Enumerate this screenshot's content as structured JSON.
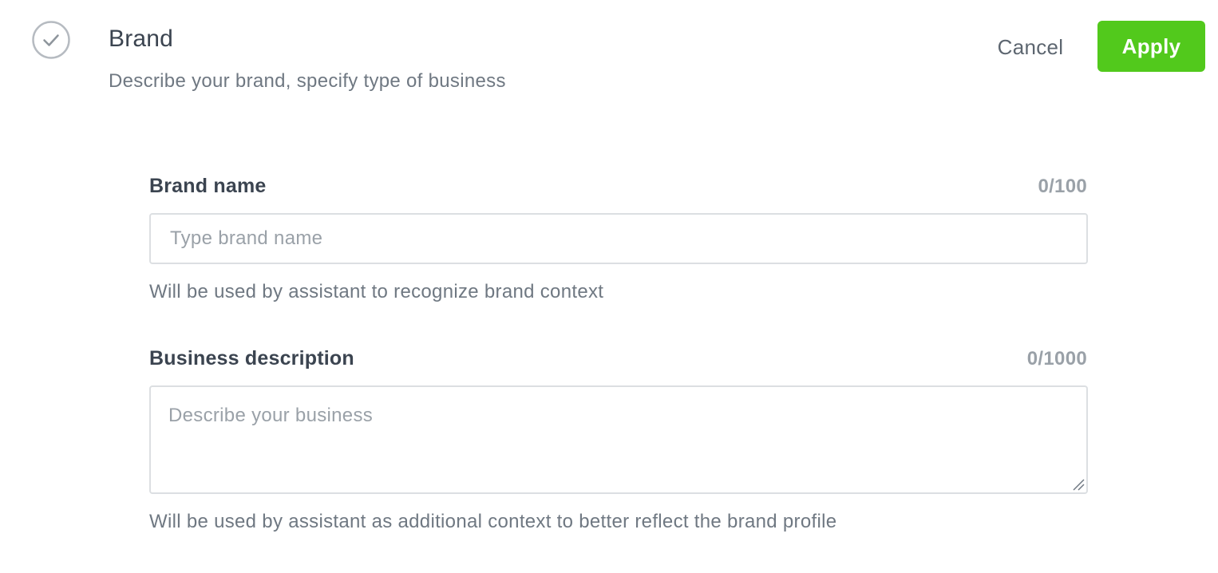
{
  "header": {
    "title": "Brand",
    "subtitle": "Describe your brand, specify type of business",
    "status_icon": "check-circle-icon",
    "cancel_label": "Cancel",
    "apply_label": "Apply"
  },
  "colors": {
    "apply_background": "#52c91c",
    "title_text": "#3b4450",
    "muted_text": "#6f7882",
    "counter_text": "#9aa1a8",
    "input_border": "#dcdfe2"
  },
  "fields": {
    "brand_name": {
      "label": "Brand name",
      "counter": "0/100",
      "value": "",
      "placeholder": "Type brand name",
      "hint": "Will be used by assistant to recognize brand context"
    },
    "business_description": {
      "label": "Business description",
      "counter": "0/1000",
      "value": "",
      "placeholder": "Describe your business",
      "hint": "Will be used by assistant as additional context to better reflect the brand profile",
      "resize_icon": "resize-handle-icon"
    }
  }
}
